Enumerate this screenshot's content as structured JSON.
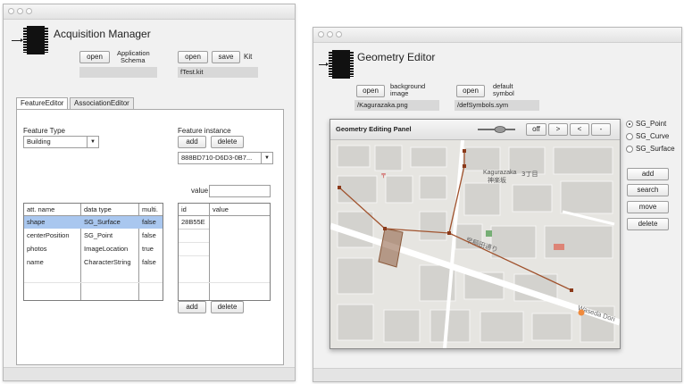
{
  "acq": {
    "title": "Acquisition Manager",
    "open_label": "open",
    "schema_label_line1": "Application",
    "schema_label_line2": "Schema",
    "schema_value": "",
    "kit_open_label": "open",
    "kit_save_label": "save",
    "kit_label": "Kit",
    "kit_value": "fTest.kit",
    "tabs": [
      "FeatureEditor",
      "AssociationEditor"
    ],
    "feature_type_label": "Feature Type",
    "feature_type_value": "Building",
    "feature_instance_label": "Feature instance",
    "add_label": "add",
    "delete_label": "delete",
    "instance_value": "888BD710-D6D3-0B7...",
    "value_label": "value",
    "value_input": "",
    "attr_headers": [
      "att. name",
      "data type",
      "multi."
    ],
    "attr_rows": [
      [
        "shape",
        "SG_Surface",
        "false"
      ],
      [
        "centerPosition",
        "SG_Point",
        "false"
      ],
      [
        "photos",
        "ImageLocation",
        "true"
      ],
      [
        "name",
        "CharacterString",
        "false"
      ]
    ],
    "value_headers": [
      "id",
      "value"
    ],
    "value_rows": [
      [
        "28B55E",
        ""
      ]
    ],
    "bottom_add_label": "add",
    "bottom_delete_label": "delete",
    "selected_color": "#a9c7ef"
  },
  "geo": {
    "title": "Geometry Editor",
    "bg_open_label": "open",
    "bg_label_line1": "background",
    "bg_label_line2": "image",
    "bg_value": "/Kagurazaka.png",
    "sym_open_label": "open",
    "sym_label_line1": "default",
    "sym_label_line2": "symbol",
    "sym_value": "/defSymbols.sym",
    "panel_title": "Geometry Editing Panel",
    "off_label": "off",
    "next_label": ">",
    "prev_label": "<",
    "minus_label": "-",
    "radios": [
      "SG_Point",
      "SG_Curve",
      "SG_Surface"
    ],
    "selected_radio": "SG_Point",
    "actions": [
      "add",
      "search",
      "move",
      "delete"
    ],
    "map_labels": {
      "kagurazaka": "Kagurazaka",
      "kagurazaka_jp": "神楽坂",
      "chome": "3丁目",
      "street": "早稲田通り",
      "waseda": "Waseda Dori",
      "pin": "〒"
    },
    "line_color": "#a0522d",
    "polygon_color": "#8b5a3c"
  }
}
